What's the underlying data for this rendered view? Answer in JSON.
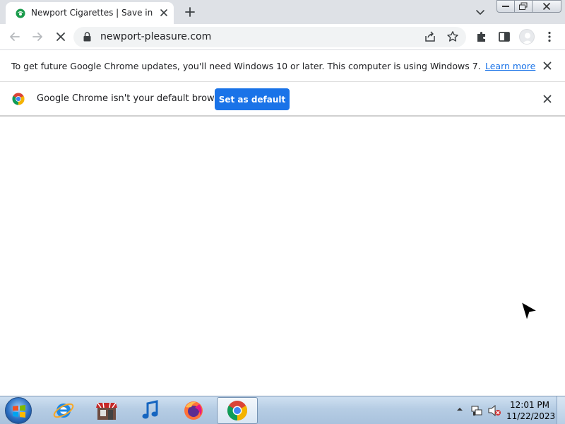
{
  "browser": {
    "tab": {
      "title": "Newport Cigarettes | Save in-store",
      "favicon": "newport-logo-icon"
    },
    "new_tab_icon": "plus-icon",
    "address": {
      "url": "newport-pleasure.com"
    },
    "accent_color": "#1a73e8"
  },
  "infobars": {
    "update_notice": {
      "text": "To get future Google Chrome updates, you'll need Windows 10 or later. This computer is using Windows 7.",
      "link": "Learn more"
    },
    "default_browser": {
      "text": "Google Chrome isn't your default browser",
      "button": "Set as default"
    }
  },
  "taskbar": {
    "apps": [
      "internet-explorer-icon",
      "store-icon",
      "itunes-icon",
      "firefox-icon",
      "chrome-icon"
    ],
    "clock": {
      "time": "12:01 PM",
      "date": "11/22/2023"
    }
  }
}
